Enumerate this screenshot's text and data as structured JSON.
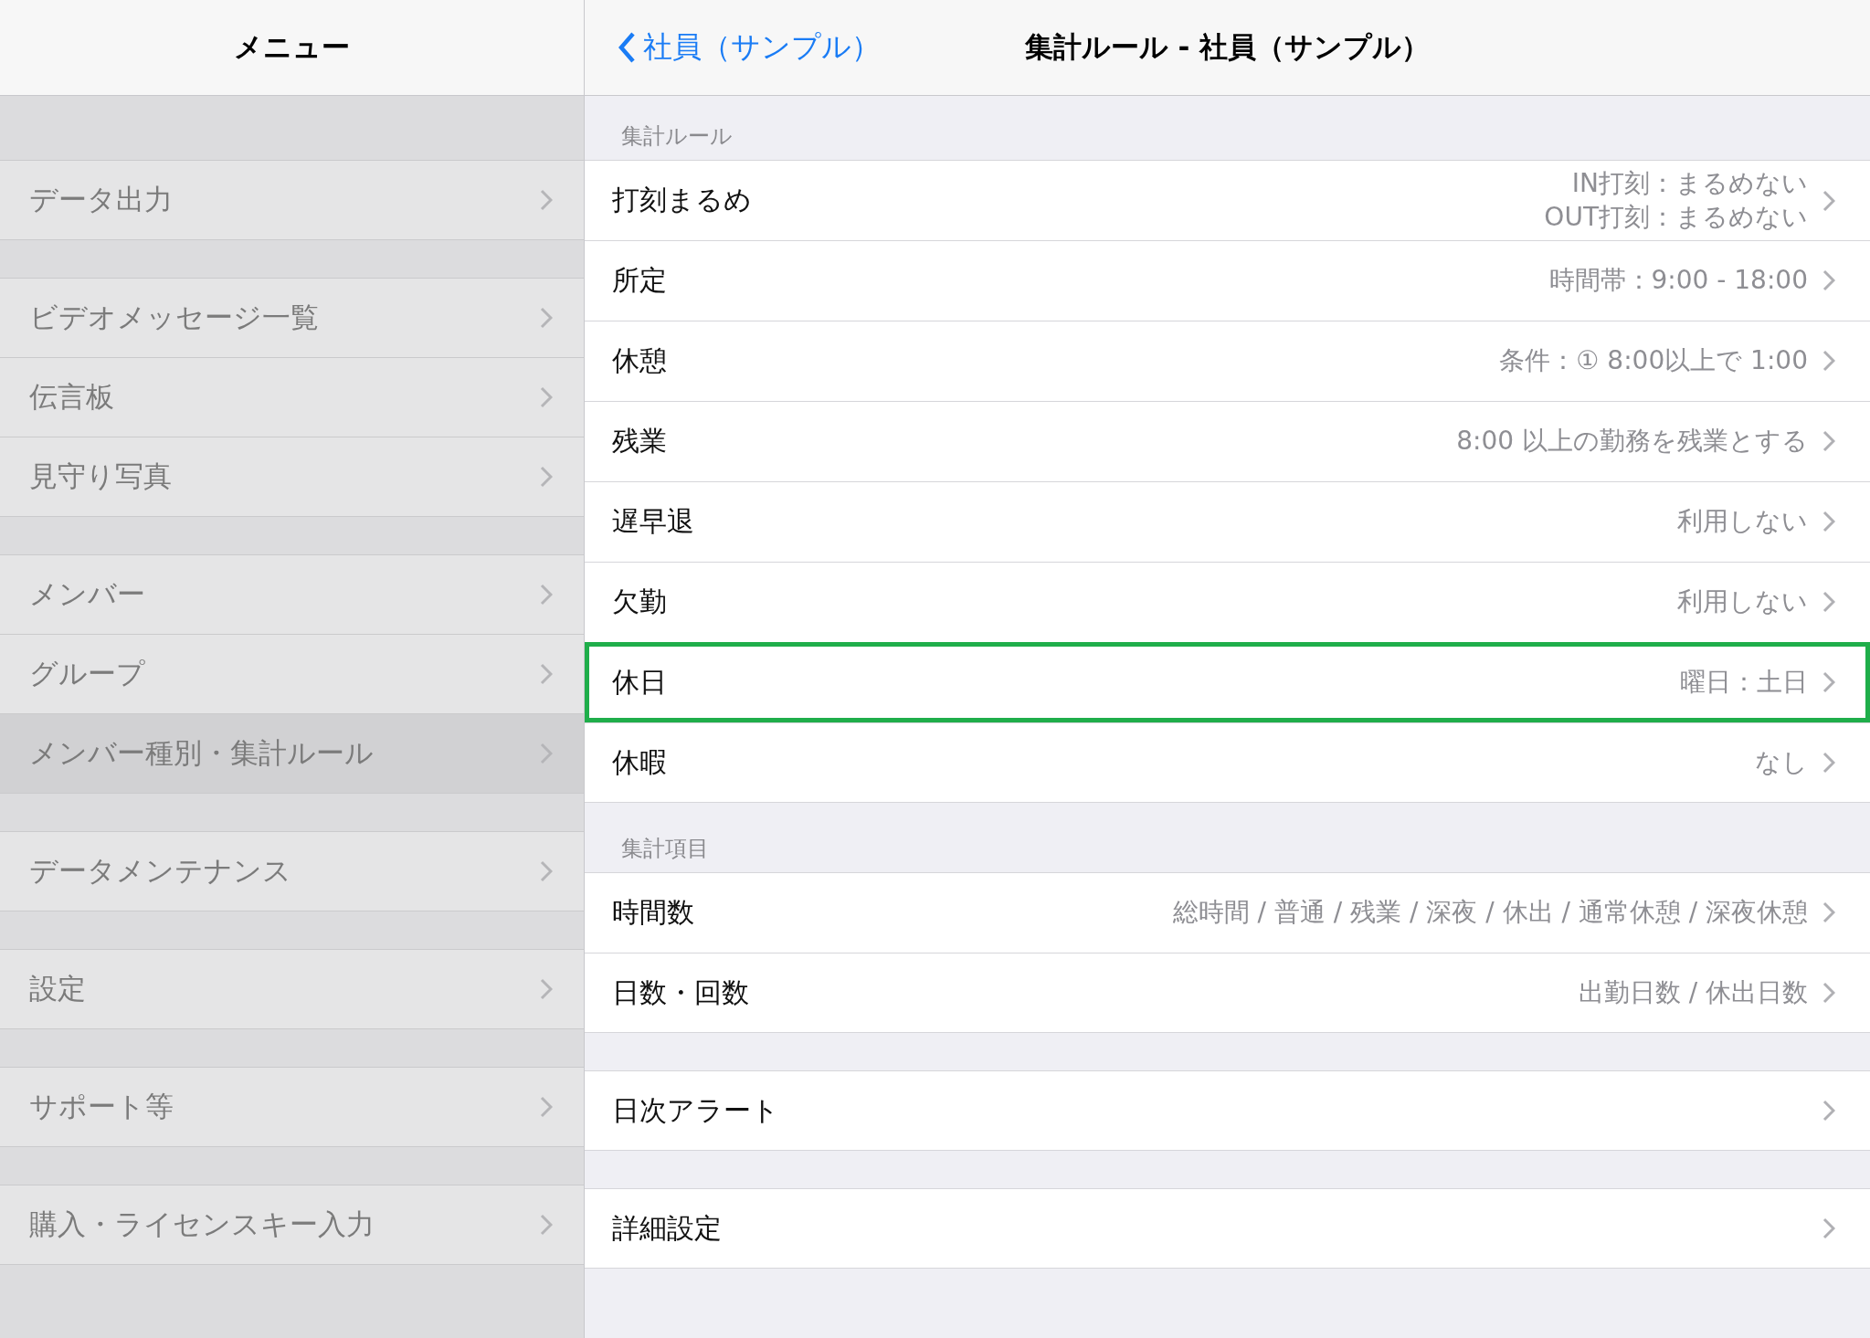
{
  "sidebar": {
    "title": "メニュー",
    "sections": [
      {
        "items": [
          {
            "label": "データ出力",
            "selected": false
          }
        ]
      },
      {
        "items": [
          {
            "label": "ビデオメッセージ一覧",
            "selected": false
          },
          {
            "label": "伝言板",
            "selected": false
          },
          {
            "label": "見守り写真",
            "selected": false
          }
        ]
      },
      {
        "items": [
          {
            "label": "メンバー",
            "selected": false
          },
          {
            "label": "グループ",
            "selected": false
          },
          {
            "label": "メンバー種別・集計ルール",
            "selected": true
          }
        ]
      },
      {
        "items": [
          {
            "label": "データメンテナンス",
            "selected": false
          }
        ]
      },
      {
        "items": [
          {
            "label": "設定",
            "selected": false
          }
        ]
      },
      {
        "items": [
          {
            "label": "サポート等",
            "selected": false
          }
        ]
      },
      {
        "items": [
          {
            "label": "購入・ライセンスキー入力",
            "selected": false
          }
        ]
      }
    ]
  },
  "nav_bar": {
    "back": "社員（サンプル）",
    "title": "集計ルール - 社員（サンプル）"
  },
  "sections": [
    {
      "header": "集計ルール",
      "rows": [
        {
          "label": "打刻まるめ",
          "value": [
            "IN打刻：まるめない",
            "OUT打刻：まるめない"
          ],
          "highlighted": false
        },
        {
          "label": "所定",
          "value": [
            "時間帯：9:00 - 18:00"
          ],
          "highlighted": false
        },
        {
          "label": "休憩",
          "value": [
            "条件：① 8:00以上で 1:00"
          ],
          "highlighted": false
        },
        {
          "label": "残業",
          "value": [
            "8:00 以上の勤務を残業とする"
          ],
          "highlighted": false
        },
        {
          "label": "遅早退",
          "value": [
            "利用しない"
          ],
          "highlighted": false
        },
        {
          "label": "欠勤",
          "value": [
            "利用しない"
          ],
          "highlighted": false
        },
        {
          "label": "休日",
          "value": [
            "曜日：土日"
          ],
          "highlighted": true
        },
        {
          "label": "休暇",
          "value": [
            "なし"
          ],
          "highlighted": false
        }
      ]
    },
    {
      "header": "集計項目",
      "rows": [
        {
          "label": "時間数",
          "value": [
            "総時間 / 普通 / 残業 / 深夜 / 休出 / 通常休憩 / 深夜休憩"
          ],
          "highlighted": false
        },
        {
          "label": "日数・回数",
          "value": [
            "出勤日数 / 休出日数"
          ],
          "highlighted": false
        }
      ]
    },
    {
      "rows": [
        {
          "label": "日次アラート",
          "highlighted": false
        }
      ]
    },
    {
      "rows": [
        {
          "label": "詳細設定",
          "highlighted": false
        }
      ]
    }
  ]
}
